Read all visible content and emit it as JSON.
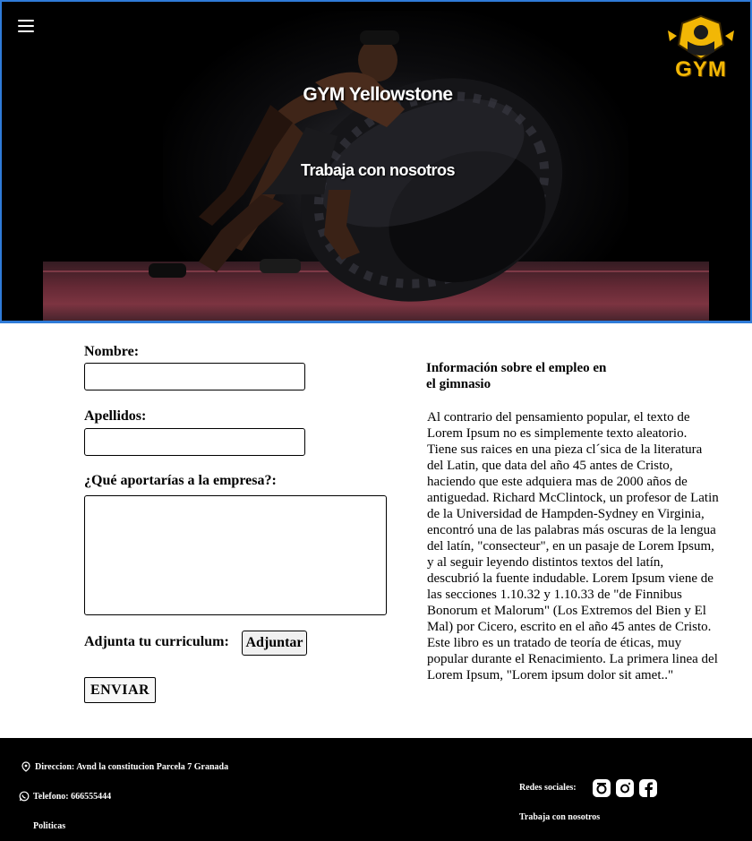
{
  "hero": {
    "title": "GYM Yellowstone",
    "subtitle": "Trabaja con nosotros",
    "logo_text": "GYM",
    "accent_color": "#f2b705",
    "border_color": "#2f7bd8"
  },
  "form": {
    "nombre_label": "Nombre:",
    "nombre_value": "",
    "apellidos_label": "Apellidos:",
    "apellidos_value": "",
    "aporta_label": "¿Qué aportarías a la empresa?:",
    "aporta_value": "",
    "cv_label": "Adjunta tu curriculum:",
    "adjuntar_button": "Adjuntar",
    "enviar_button": "ENVIAR"
  },
  "info": {
    "title": "Información sobre el empleo en el gimnasio",
    "body": "Al contrario del pensamiento popular, el texto de Lorem Ipsum no es simplemente texto aleatorio. Tiene sus raices en una pieza cl´sica de la literatura del Latin, que data del año 45 antes de Cristo, haciendo que este adquiera mas de 2000 años de antiguedad. Richard McClintock, un profesor de Latin de la Universidad de Hampden-Sydney en Virginia, encontró una de las palabras más oscuras de la lengua del latín, \"consecteur\", en un pasaje de Lorem Ipsum, y al seguir leyendo distintos textos del latín, descubrió la fuente indudable. Lorem Ipsum viene de las secciones 1.10.32 y 1.10.33 de \"de Finnibus Bonorum et Malorum\" (Los Extremos del Bien y El Mal) por Cicero, escrito en el año 45 antes de Cristo. Este libro es un tratado de teoría de éticas, muy popular durante el Renacimiento. La primera linea del Lorem Ipsum, \"Lorem ipsum dolor sit amet..\""
  },
  "footer": {
    "address": "Direccion:  Avnd la constitucion Parcela 7 Granada",
    "phone": "Telefono: 666555444",
    "policies": "Politicas",
    "social_label": "Redes sociales:",
    "work_link": "Trabaja con nosotros",
    "social_icons": [
      "threads-icon",
      "instagram-icon",
      "facebook-icon"
    ]
  }
}
